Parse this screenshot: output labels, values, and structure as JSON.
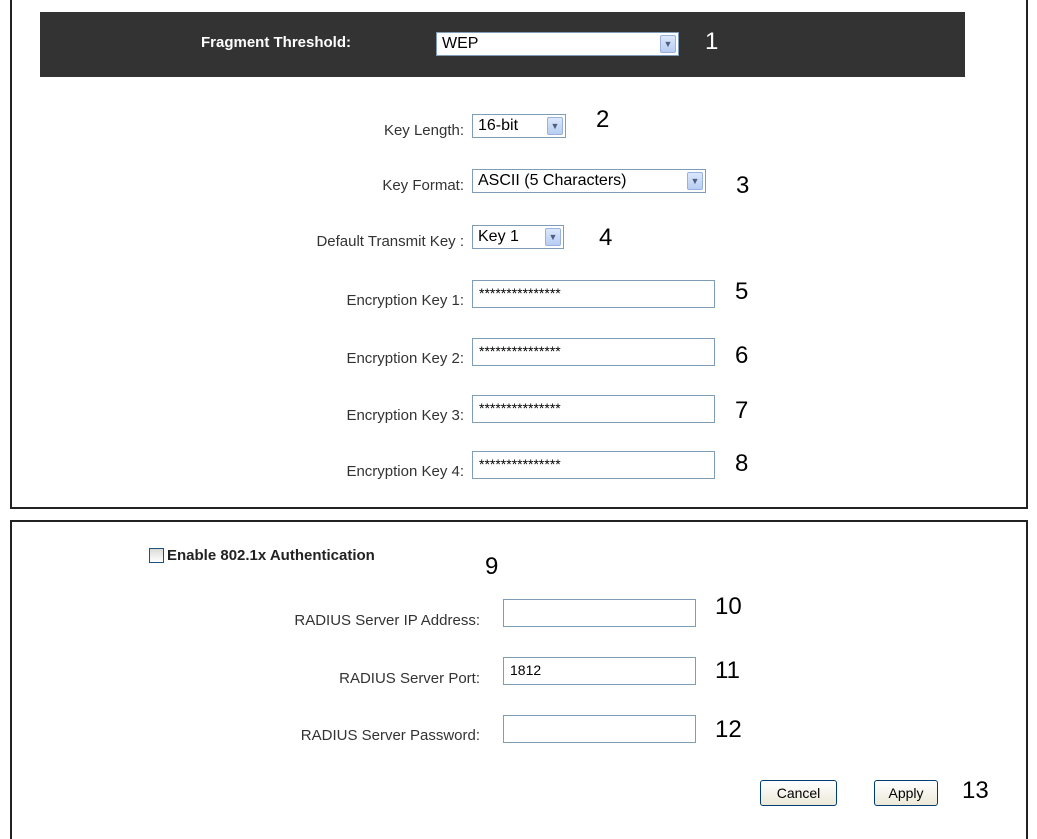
{
  "wep": {
    "fragment_label": "Fragment Threshold:",
    "fragment_value": "WEP",
    "key_length_label": "Key Length:",
    "key_length_value": "16-bit",
    "key_format_label": "Key Format:",
    "key_format_value": "ASCII (5 Characters)",
    "default_key_label": "Default Transmit Key :",
    "default_key_value": "Key 1",
    "keys": [
      {
        "label": "Encryption Key 1:",
        "value": "***************"
      },
      {
        "label": "Encryption Key 2:",
        "value": "***************"
      },
      {
        "label": "Encryption Key 3:",
        "value": "***************"
      },
      {
        "label": "Encryption Key 4:",
        "value": "***************"
      }
    ]
  },
  "auth": {
    "enable_label": "Enable 802.1x Authentication",
    "radius_ip_label": "RADIUS Server IP Address:",
    "radius_ip_value": "",
    "radius_port_label": "RADIUS Server Port:",
    "radius_port_value": "1812",
    "radius_password_label": "RADIUS Server Password:",
    "radius_password_value": ""
  },
  "buttons": {
    "cancel": "Cancel",
    "apply": "Apply"
  },
  "callouts": [
    "1",
    "2",
    "3",
    "4",
    "5",
    "6",
    "7",
    "8",
    "9",
    "10",
    "11",
    "12",
    "13"
  ]
}
